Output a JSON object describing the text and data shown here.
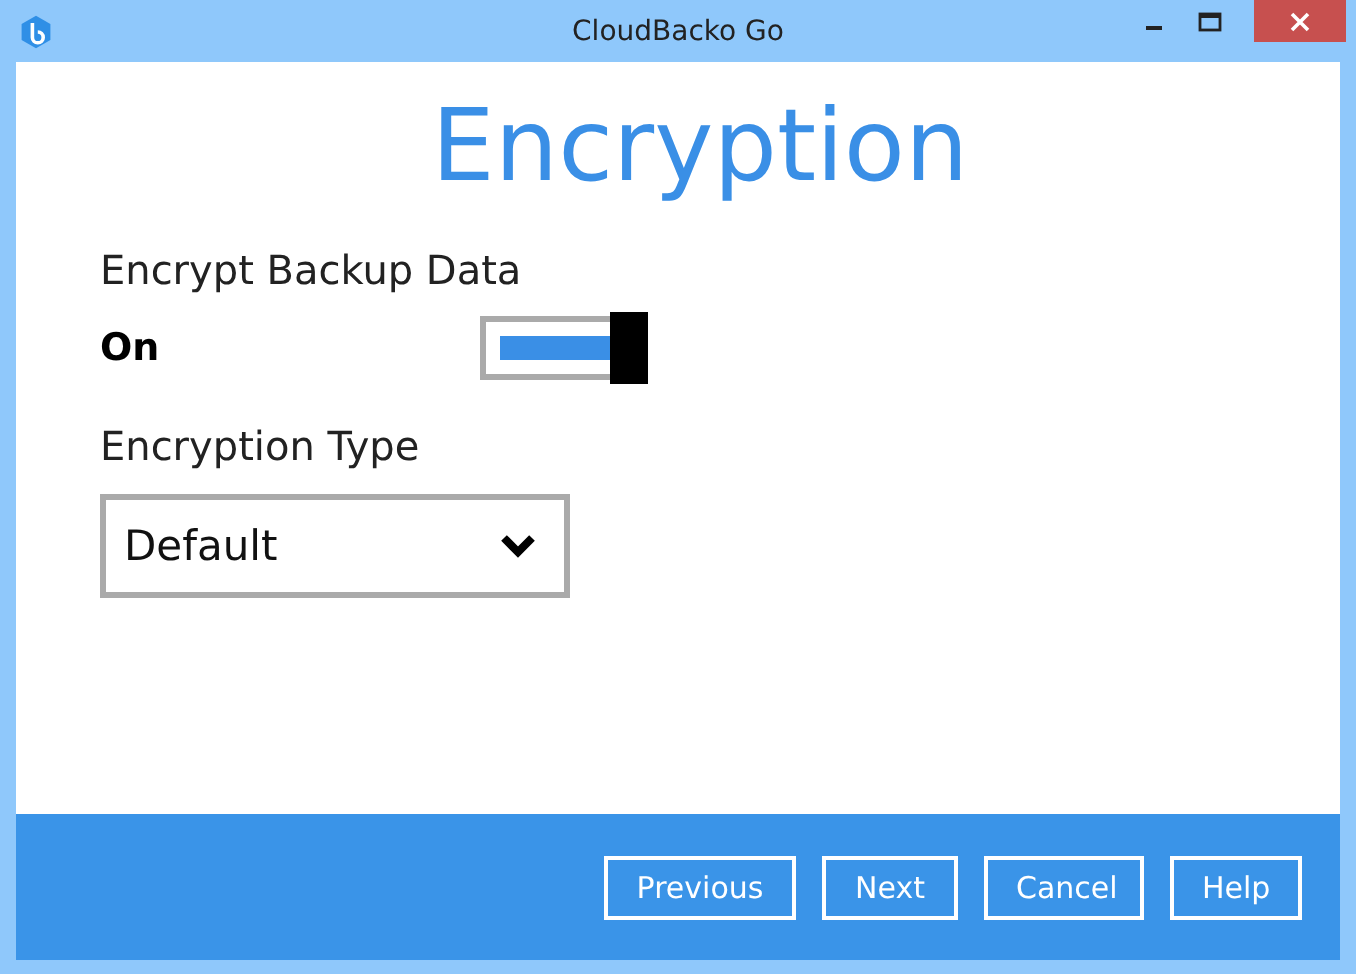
{
  "window": {
    "title": "CloudBacko Go"
  },
  "heading": "Encryption",
  "encrypt": {
    "label": "Encrypt Backup Data",
    "state_text": "On",
    "on": true
  },
  "encryption_type": {
    "label": "Encryption Type",
    "value": "Default"
  },
  "buttons": [
    "Previous",
    "Next",
    "Cancel",
    "Help"
  ]
}
